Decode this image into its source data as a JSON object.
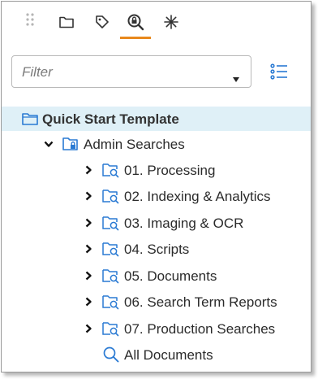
{
  "toolbar": {
    "tabs": [
      {
        "name": "folder-icon"
      },
      {
        "name": "tag-icon"
      },
      {
        "name": "saved-search-icon"
      },
      {
        "name": "asterisk-icon"
      }
    ],
    "active_tab": 2,
    "accent_color": "#e8891d"
  },
  "filter": {
    "placeholder": "Filter",
    "value": ""
  },
  "tree": {
    "root": {
      "label": "Quick Start Template",
      "icon": "folder-icon",
      "selected": true
    },
    "admin": {
      "label": "Admin Searches",
      "icon": "secured-search-folder-icon",
      "expanded": true
    },
    "children": [
      {
        "label": "01. Processing"
      },
      {
        "label": "02. Indexing & Analytics"
      },
      {
        "label": "03. Imaging & OCR"
      },
      {
        "label": "04. Scripts"
      },
      {
        "label": "05. Documents"
      },
      {
        "label": "06. Search Term Reports"
      },
      {
        "label": "07. Production Searches"
      }
    ],
    "all_documents": {
      "label": "All Documents",
      "icon": "search-icon"
    }
  },
  "colors": {
    "icon_blue": "#2a7ad3",
    "selected_bg": "#dff0f7"
  }
}
